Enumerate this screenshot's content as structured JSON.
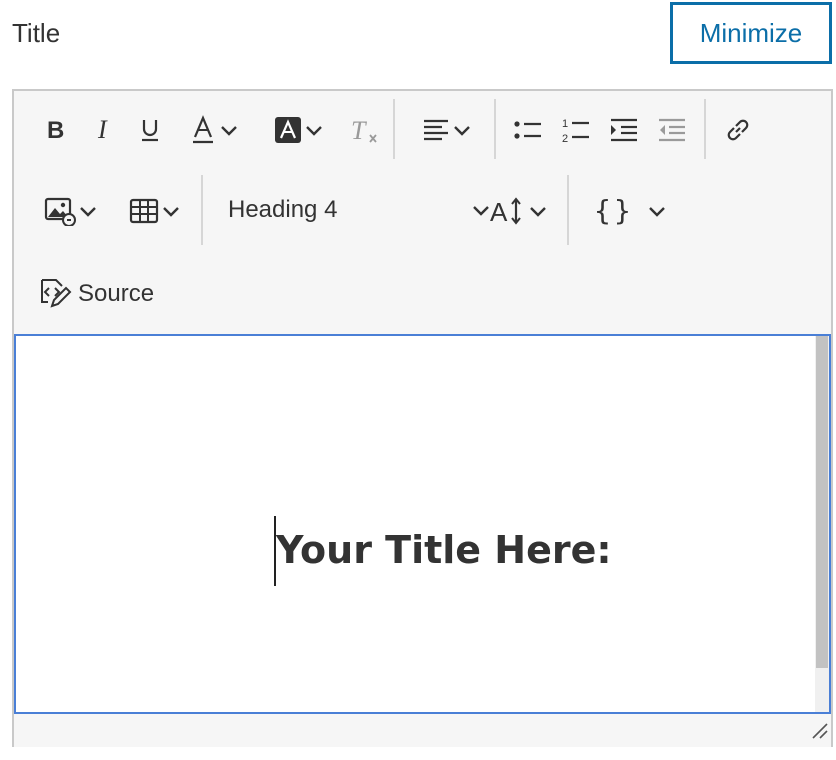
{
  "field": {
    "label": "Title"
  },
  "header": {
    "minimize_label": "Minimize"
  },
  "toolbar": {
    "row1": [
      "bold-icon",
      "italic-icon",
      "underline-icon",
      "font-color-icon",
      "highlight-icon",
      "clear-format-icon",
      "align-icon",
      "bulleted-list-icon",
      "numbered-list-icon",
      "indent-icon",
      "outdent-icon",
      "link-icon"
    ],
    "row2": [
      "insert-image-icon",
      "table-icon",
      "text-size-icon",
      "code-braces-icon"
    ],
    "heading_value": "Heading 4",
    "source_label": "Source"
  },
  "content": {
    "text": "Your Title Here:"
  },
  "colors": {
    "accent": "#0b6ea8",
    "focus": "#4a7fd6",
    "toolbar_bg": "#f6f6f6"
  }
}
